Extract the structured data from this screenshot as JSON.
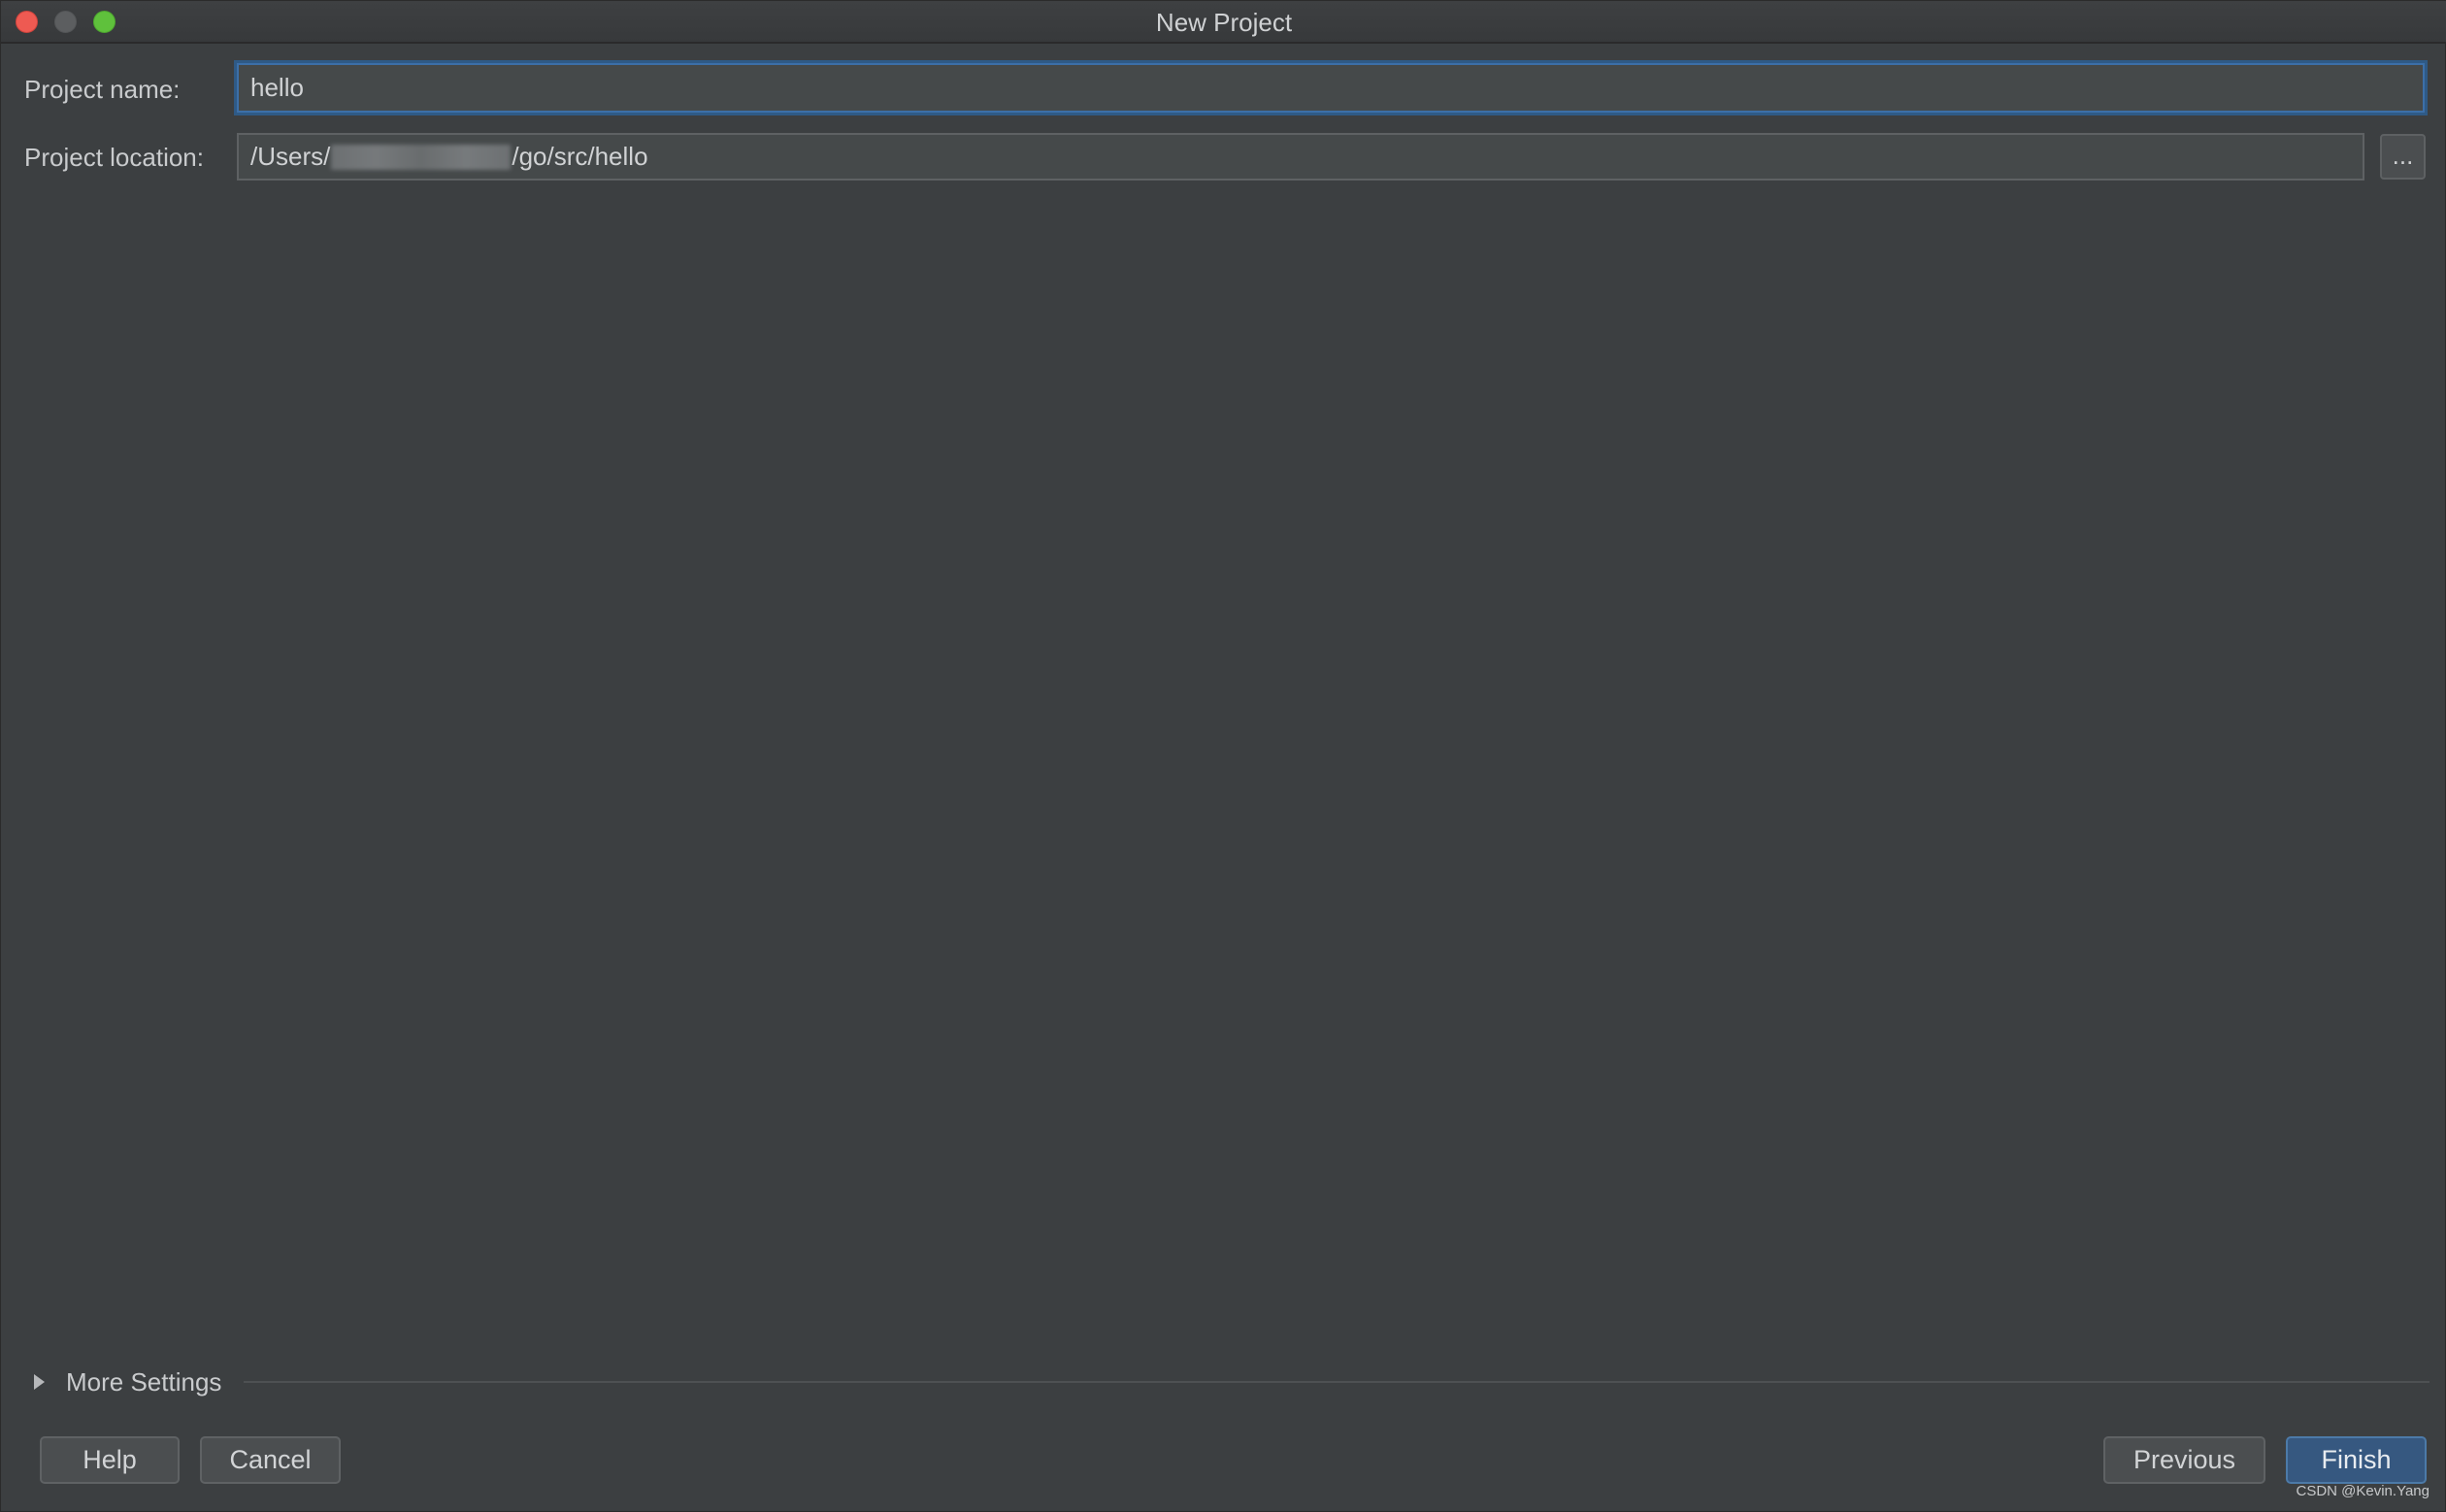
{
  "window": {
    "title": "New Project"
  },
  "form": {
    "project_name_label": "Project name:",
    "project_name_value": "hello",
    "project_location_label": "Project location:",
    "project_location_prefix": "/Users/",
    "project_location_suffix": "/go/src/hello",
    "browse_label": "..."
  },
  "more_settings": {
    "label": "More Settings"
  },
  "footer": {
    "help_label": "Help",
    "cancel_label": "Cancel",
    "previous_label": "Previous",
    "finish_label": "Finish"
  },
  "watermark": "CSDN @Kevin.Yang",
  "colors": {
    "background": "#3c3f41",
    "accent": "#365880",
    "focus_border": "#3c6fa8",
    "close": "#ee5a52",
    "maximize": "#5fc13c"
  }
}
